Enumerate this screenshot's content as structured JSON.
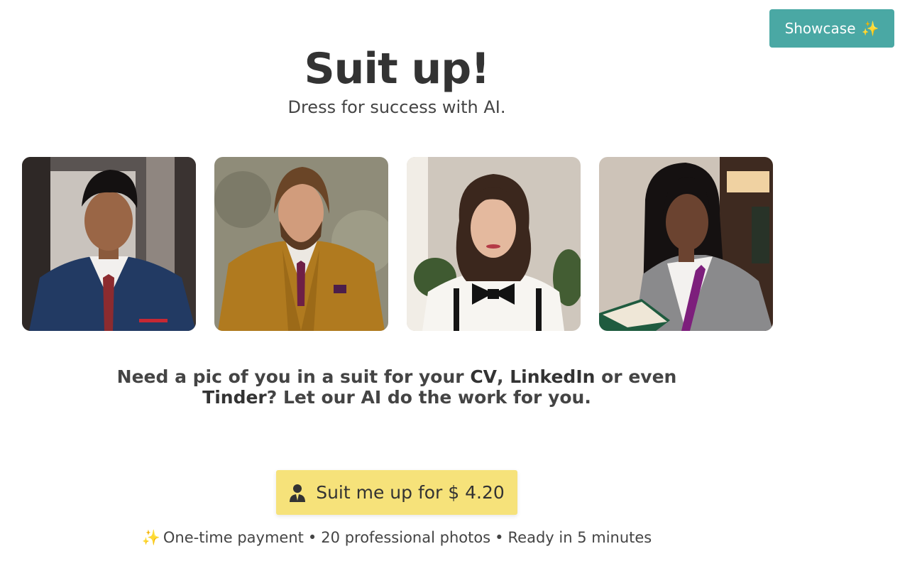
{
  "header": {
    "showcase_label": "Showcase",
    "showcase_sparkle": "✨"
  },
  "hero": {
    "title": "Suit up!",
    "subtitle": "Dress for success with AI."
  },
  "tagline": {
    "part1": "Need a pic of you in a suit for your ",
    "cv": "CV",
    "comma": ", ",
    "linkedin": "LinkedIn",
    "or_even": " or even ",
    "tinder": "Tinder",
    "rest": "? Let our AI do the work for you."
  },
  "cta": {
    "label": "Suit me up for $ 4.20",
    "icon": "user-icon"
  },
  "features": {
    "sparkle": "✨",
    "item1": "One-time payment",
    "item2": "20 professional photos",
    "item3": "Ready in 5 minutes",
    "separator": "•"
  },
  "gallery": [
    {
      "name": "man-navy-suit-photo"
    },
    {
      "name": "man-mustard-suit-photo"
    },
    {
      "name": "woman-bowtie-photo"
    },
    {
      "name": "woman-grey-suit-photo"
    }
  ],
  "colors": {
    "accent_teal": "#4aa8a4",
    "cta_yellow": "#f6e27a",
    "text_dark": "#333333"
  }
}
